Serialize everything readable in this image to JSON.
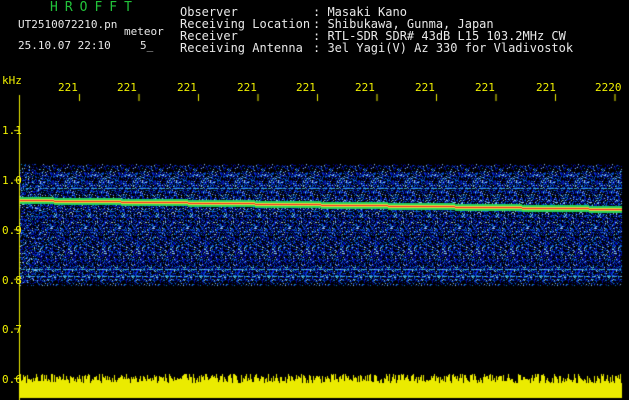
{
  "header": {
    "brand": "HROFFT",
    "file_name": "UT2510072210.pn",
    "event_type": "meteor",
    "datetime": "25.10.07 22:10",
    "count": "5_"
  },
  "metadata": [
    {
      "label": "Observer",
      "value": ": Masaki Kano"
    },
    {
      "label": "Receiving Location",
      "value": ": Shibukawa, Gunma, Japan"
    },
    {
      "label": "Receiver",
      "value": ": RTL-SDR SDR# 43dB L15 103.2MHz CW"
    },
    {
      "label": "Receiving Antenna",
      "value": ": 3el Yagi(V) Az 330 for Vladivostok"
    }
  ],
  "axes": {
    "y_unit": "kHz",
    "y_ticks": [
      "1.1",
      "1.0",
      "0.9",
      "0.8",
      "0.7",
      "0.6"
    ],
    "x_ticks": [
      "221",
      "221",
      "221",
      "221",
      "221",
      "221",
      "221",
      "221",
      "221",
      "2220"
    ]
  },
  "colors": {
    "background": "#000000",
    "text_green": "#22c33a",
    "text_white": "#e8e8e8",
    "axis_yellow": "#f0f000",
    "noise_blue": "#1a3cff",
    "signal_red": "#ff2020"
  }
}
